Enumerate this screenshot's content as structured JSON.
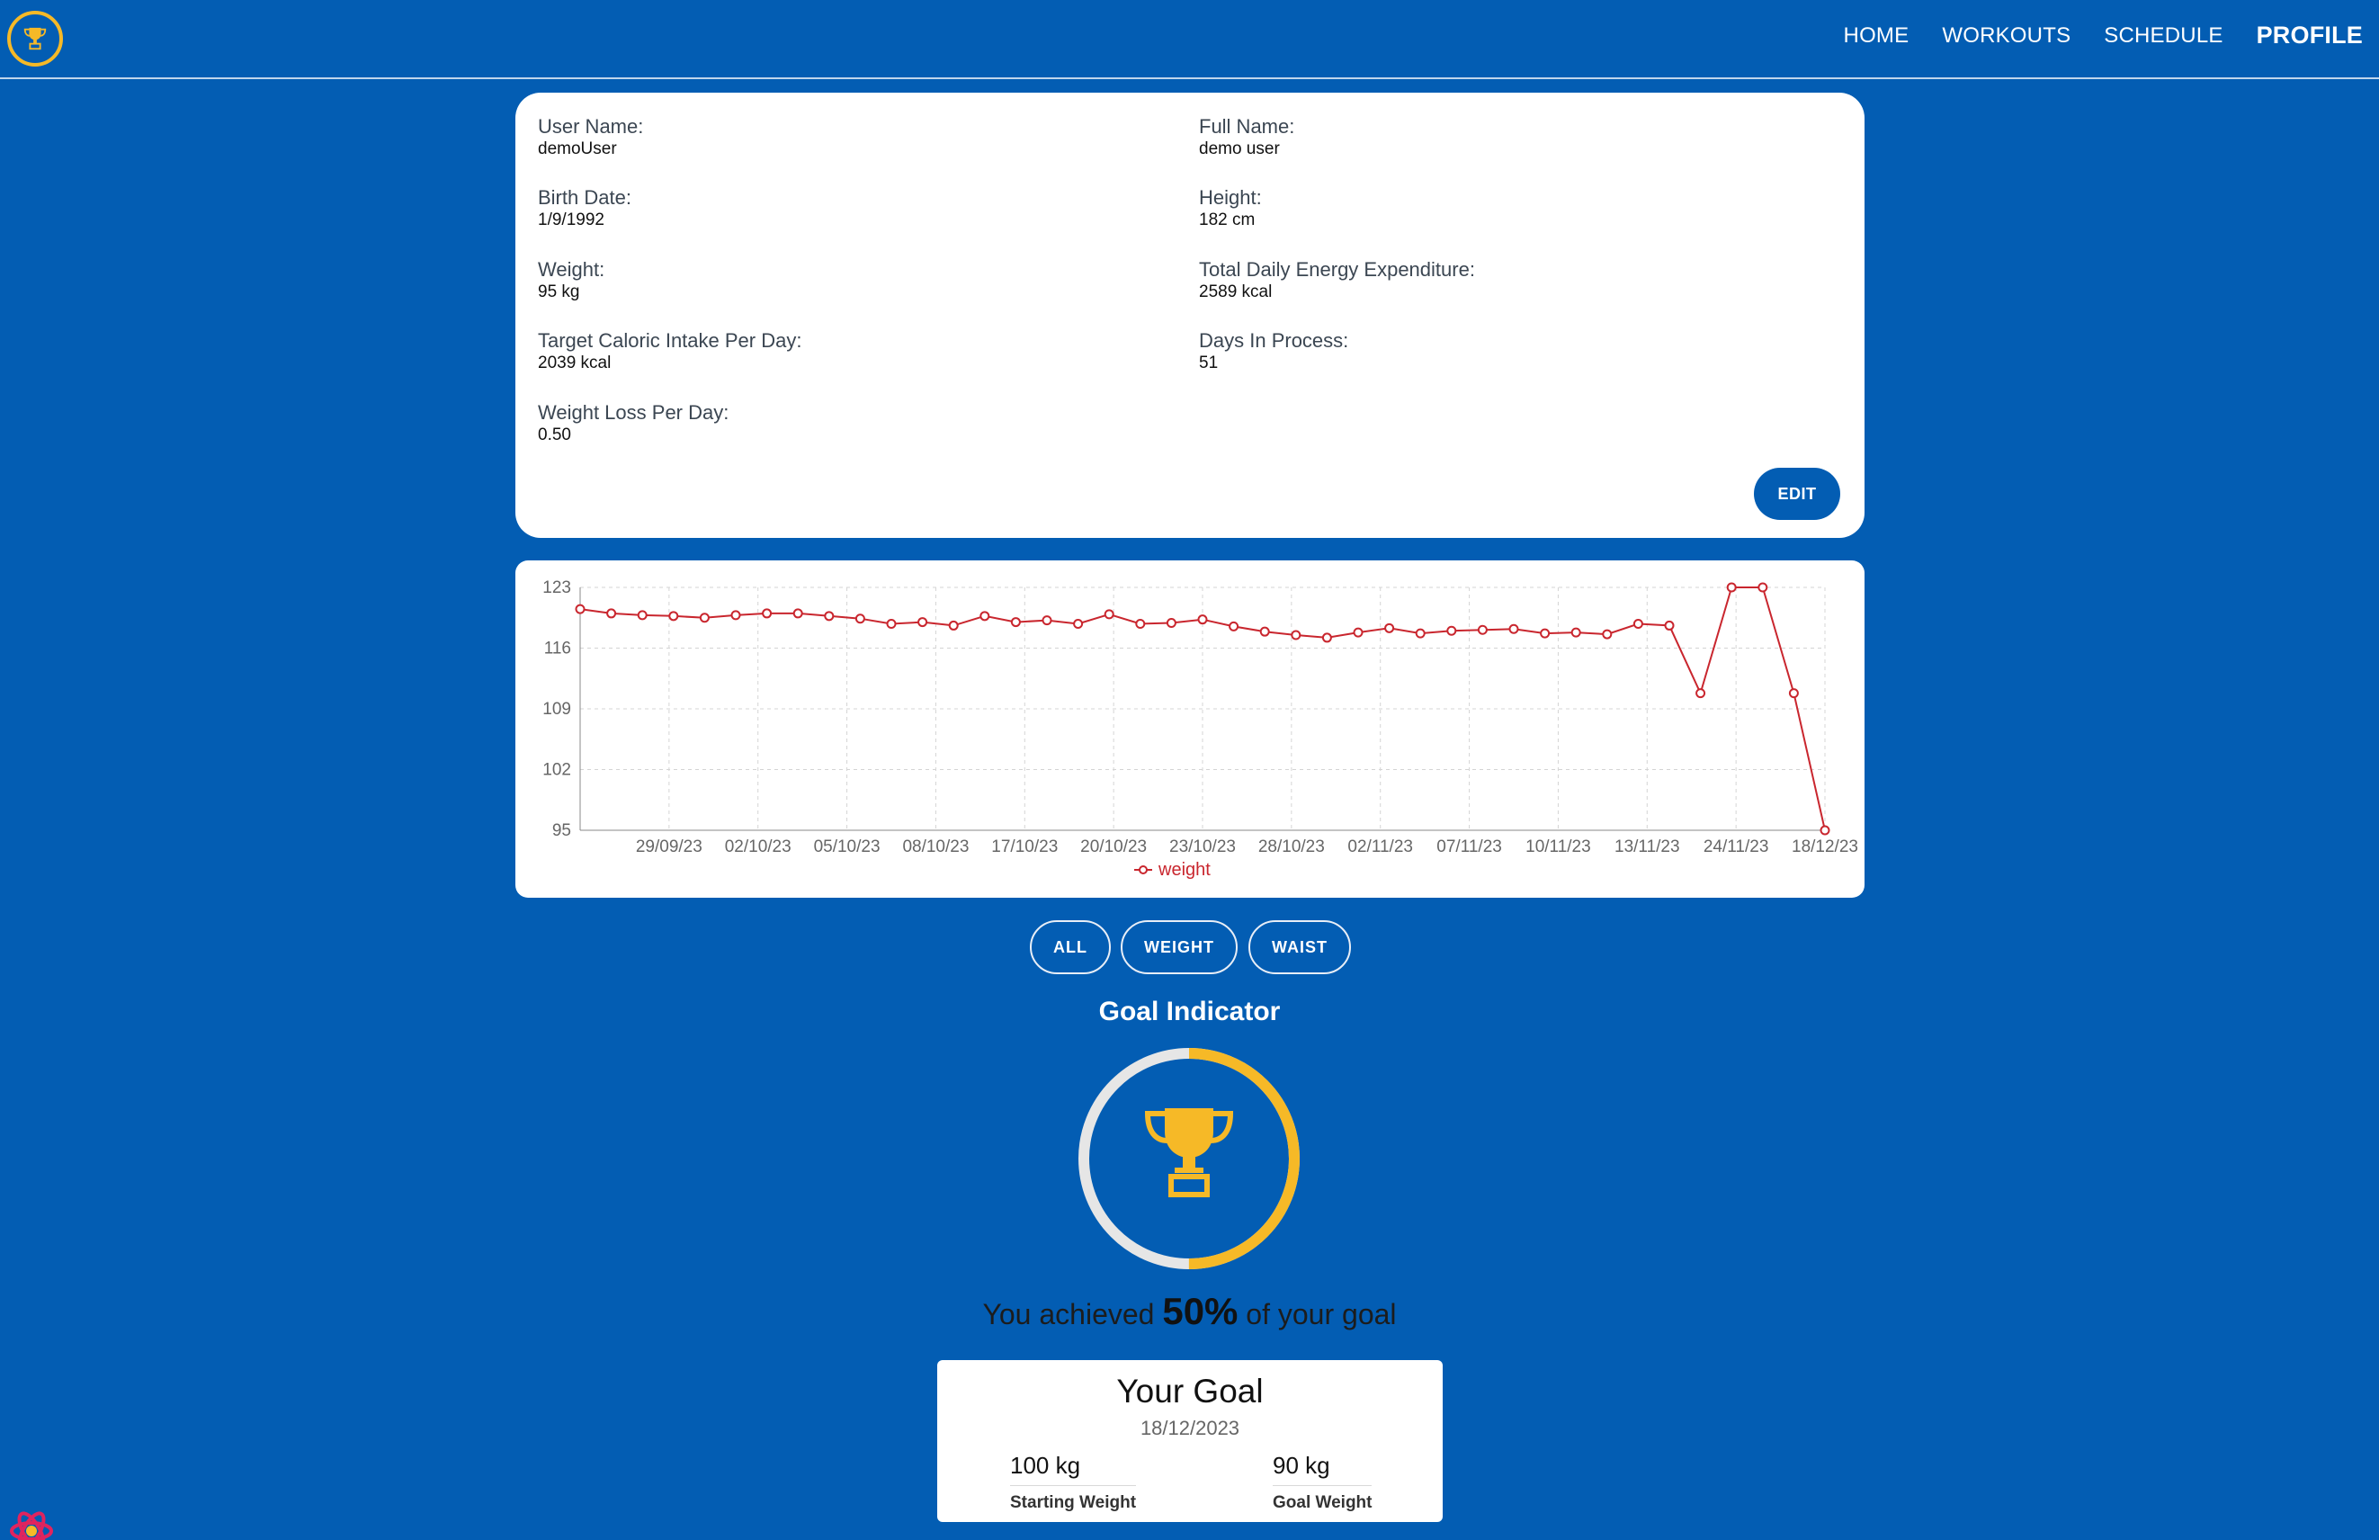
{
  "nav": {
    "logo_icon": "trophy-icon",
    "links": [
      "HOME",
      "WORKOUTS",
      "SCHEDULE",
      "PROFILE"
    ],
    "active": "PROFILE"
  },
  "profile": {
    "fields": [
      {
        "label": "User Name:",
        "value": "demoUser"
      },
      {
        "label": "Full Name:",
        "value": "demo user"
      },
      {
        "label": "Birth Date:",
        "value": "1/9/1992"
      },
      {
        "label": "Height:",
        "value": "182 cm"
      },
      {
        "label": "Weight:",
        "value": "95 kg"
      },
      {
        "label": "Total Daily Energy Expenditure:",
        "value": "2589 kcal"
      },
      {
        "label": "Target Caloric Intake Per Day:",
        "value": "2039 kcal"
      },
      {
        "label": "Days In Process:",
        "value": "51"
      },
      {
        "label": "Weight Loss Per Day:",
        "value": "0.50"
      }
    ],
    "edit_label": "EDIT"
  },
  "chart_data": {
    "type": "line",
    "x_tick_labels": [
      "29/09/23",
      "02/10/23",
      "05/10/23",
      "08/10/23",
      "17/10/23",
      "20/10/23",
      "23/10/23",
      "28/10/23",
      "02/11/23",
      "07/11/23",
      "10/11/23",
      "13/11/23",
      "24/11/23",
      "18/12/23"
    ],
    "ylim": [
      95,
      123
    ],
    "yticks": [
      95,
      102,
      109,
      116,
      123
    ],
    "grid": true,
    "legend_position": "bottom",
    "series": [
      {
        "name": "weight",
        "color": "#c9262e",
        "values": [
          120.5,
          120.0,
          119.8,
          119.7,
          119.5,
          119.8,
          120.0,
          120.0,
          119.7,
          119.4,
          118.8,
          119.0,
          118.6,
          119.7,
          119.0,
          119.2,
          118.8,
          119.9,
          118.8,
          118.9,
          119.3,
          118.5,
          117.9,
          117.5,
          117.2,
          117.8,
          118.3,
          117.7,
          118.0,
          118.1,
          118.2,
          117.7,
          117.8,
          117.6,
          118.8,
          118.6,
          110.8,
          123.0,
          123.0,
          110.8,
          95.0
        ]
      }
    ]
  },
  "filters": [
    "ALL",
    "WEIGHT",
    "WAIST"
  ],
  "goal": {
    "title": "Goal Indicator",
    "icon": "trophy-icon",
    "progress_fraction": 0.5,
    "achieved_prefix": "You achieved",
    "achieved_pct": "50%",
    "achieved_suffix": "of your goal",
    "card_title": "Your Goal",
    "card_date": "18/12/2023",
    "starting_weight": "100 kg",
    "starting_label": "Starting Weight",
    "goal_weight": "90 kg",
    "goal_label": "Goal Weight",
    "accent": "#f6b927",
    "track": "#e6e6e6"
  },
  "dev_tool_icon": "react-devtools-icon"
}
